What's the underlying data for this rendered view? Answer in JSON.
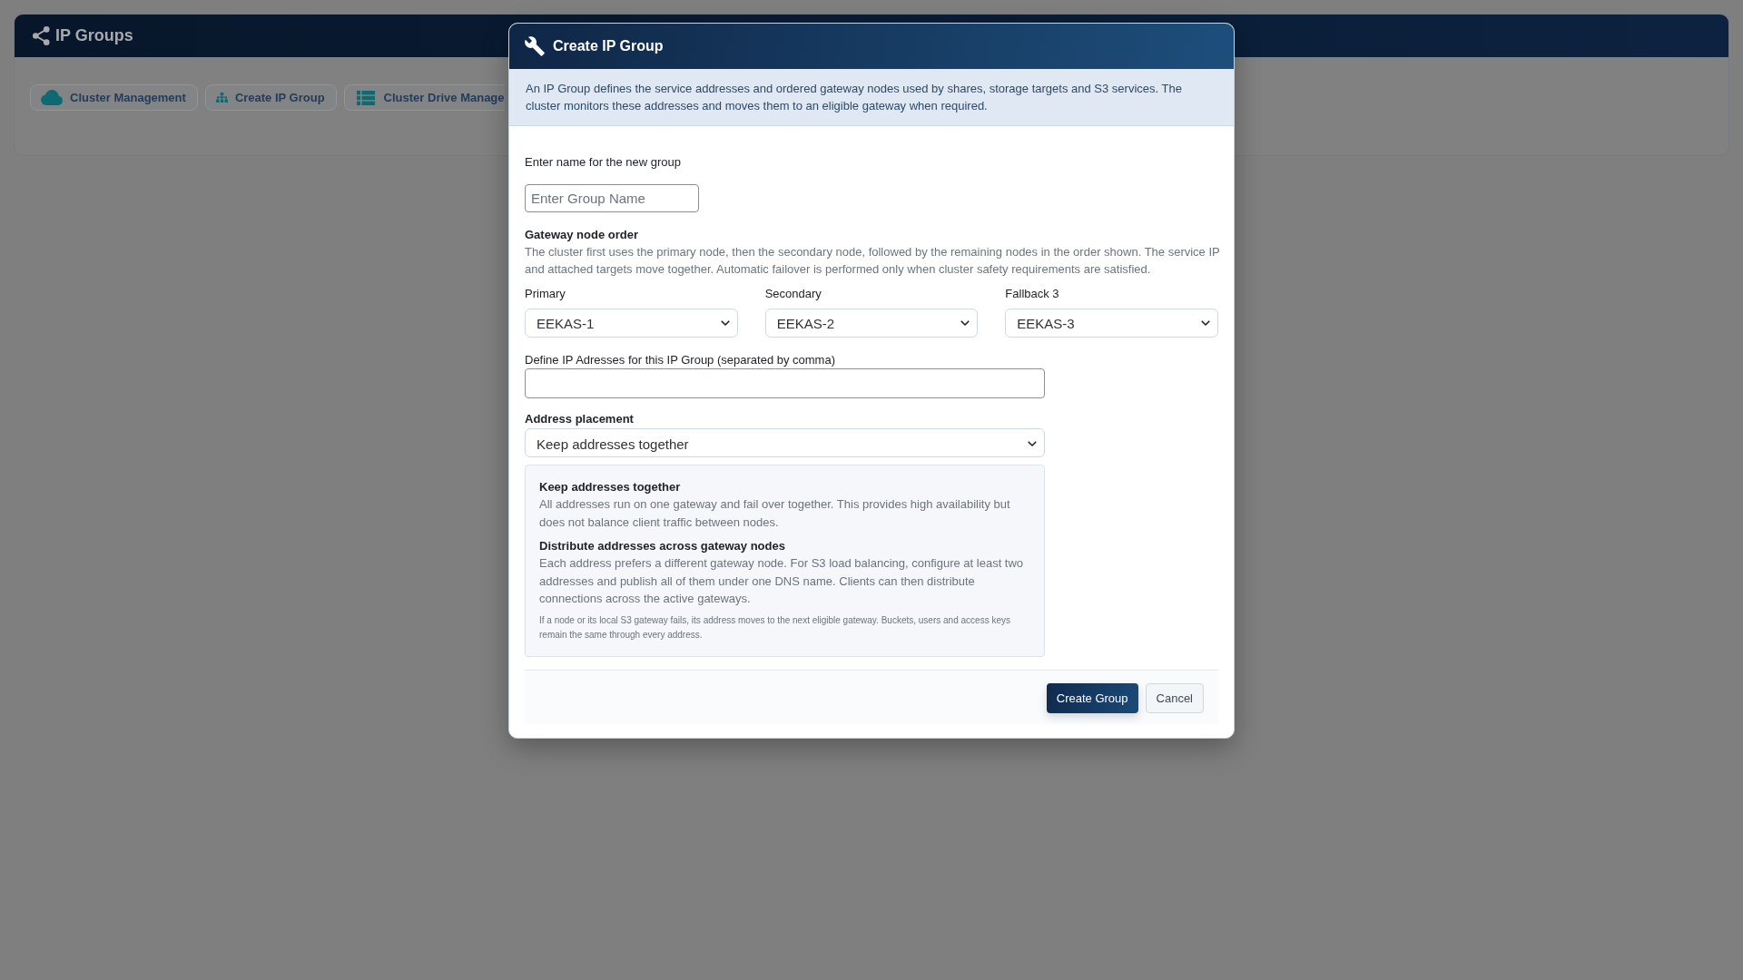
{
  "page": {
    "title": "IP Groups",
    "toolbar": [
      {
        "label": "Cluster Management"
      },
      {
        "label": "Create IP Group"
      },
      {
        "label": "Cluster Drive Manage"
      }
    ]
  },
  "dialog": {
    "title": "Create IP Group",
    "intro": "An IP Group defines the service addresses and ordered gateway nodes used by shares, storage targets and S3 services. The cluster monitors these addresses and moves them to an eligible gateway when required.",
    "group_name": {
      "label": "Enter name for the new group",
      "placeholder": "Enter Group Name"
    },
    "gateway_order": {
      "heading": "Gateway node order",
      "description": "The cluster first uses the primary node, then the secondary node, followed by the remaining nodes in the order shown. The service IP and attached targets move together. Automatic failover is performed only when cluster safety requirements are satisfied.",
      "nodes": [
        {
          "label": "Primary",
          "value": "EEKAS-1"
        },
        {
          "label": "Secondary",
          "value": "EEKAS-2"
        },
        {
          "label": "Fallback 3",
          "value": "EEKAS-3"
        }
      ]
    },
    "ip_addresses": {
      "label": "Define IP Adresses for this IP Group (separated by comma)"
    },
    "address_placement": {
      "label": "Address placement",
      "value": "Keep addresses together",
      "options": [
        {
          "title": "Keep addresses together",
          "description": "All addresses run on one gateway and fail over together. This provides high availability but does not balance client traffic between nodes."
        },
        {
          "title": "Distribute addresses across gateway nodes",
          "description": "Each address prefers a different gateway node. For S3 load balancing, configure at least two addresses and publish all of them under one DNS name. Clients can then distribute connections across the active gateways."
        }
      ],
      "note": "If a node or its local S3 gateway fails, its address moves to the next eligible gateway. Buckets, users and access keys remain the same through every address."
    },
    "buttons": [
      {
        "label": "Create Group",
        "kind": "primary"
      },
      {
        "label": "Cancel",
        "kind": "secondary"
      }
    ]
  }
}
